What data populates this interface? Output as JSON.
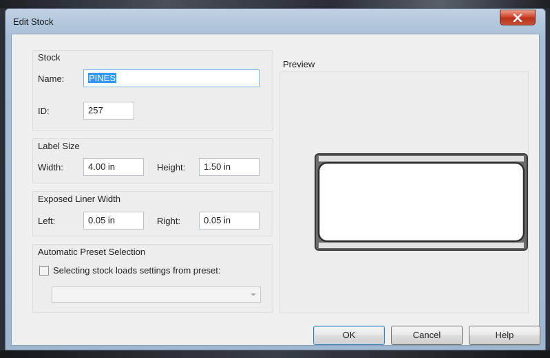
{
  "window": {
    "title": "Edit Stock"
  },
  "stock_group": {
    "label": "Stock",
    "name_label": "Name:",
    "name_value": "PINES",
    "id_label": "ID:",
    "id_value": "257"
  },
  "label_size_group": {
    "label": "Label Size",
    "width_label": "Width:",
    "width_value": "4.00 in",
    "height_label": "Height:",
    "height_value": "1.50 in"
  },
  "liner_group": {
    "label": "Exposed Liner Width",
    "left_label": "Left:",
    "left_value": "0.05 in",
    "right_label": "Right:",
    "right_value": "0.05 in"
  },
  "preset_group": {
    "label": "Automatic Preset Selection",
    "checkbox_label": "Selecting stock loads settings from preset:",
    "checkbox_checked": false,
    "preset_selected": ""
  },
  "preview": {
    "label": "Preview"
  },
  "buttons": {
    "ok": "OK",
    "cancel": "Cancel",
    "help": "Help"
  },
  "colors": {
    "accent": "#3399ff",
    "close": "#c9402a"
  },
  "icons": {
    "close": "close-icon",
    "dropdown": "chevron-down-icon"
  }
}
